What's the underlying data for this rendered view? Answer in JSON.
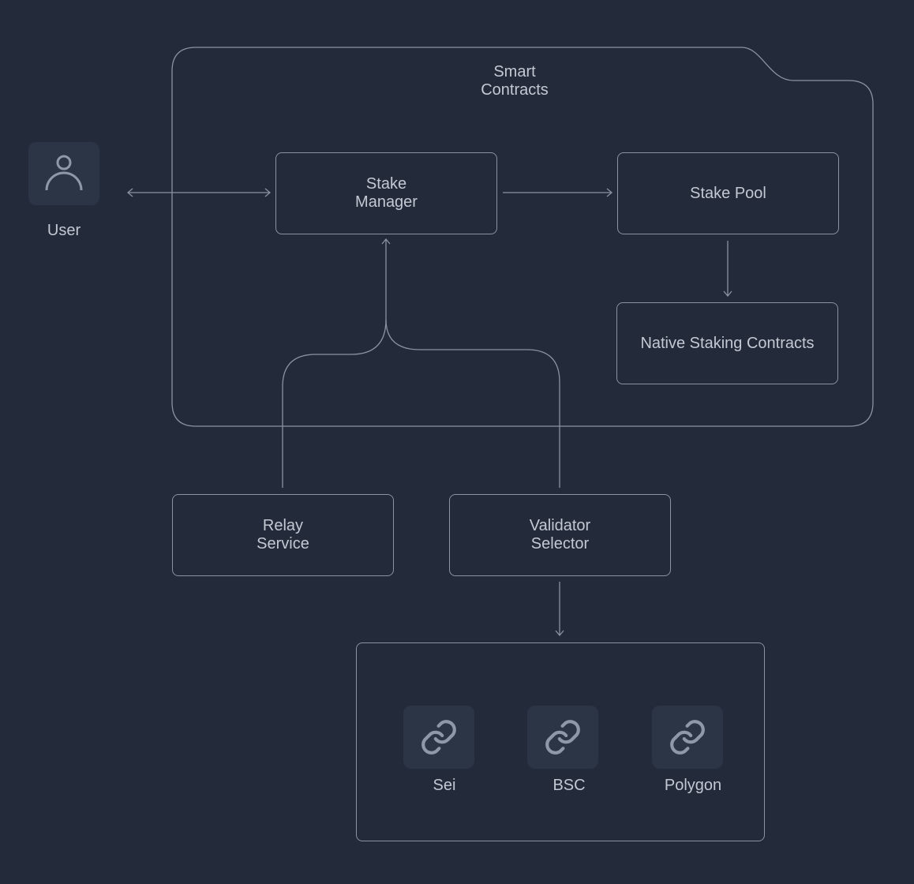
{
  "container": {
    "title": "Smart Contracts"
  },
  "user": {
    "label": "User",
    "icon": "user-icon"
  },
  "nodes": {
    "stake_manager": "Stake\nManager",
    "stake_pool": "Stake Pool",
    "native_staking": "Native Staking Contracts",
    "relay_service": "Relay\nService",
    "validator_selector": "Validator\nSelector"
  },
  "chains": [
    {
      "label": "Sei",
      "icon": "link-icon"
    },
    {
      "label": "BSC",
      "icon": "link-icon"
    },
    {
      "label": "Polygon",
      "icon": "link-icon"
    }
  ],
  "colors": {
    "background": "#232b3b",
    "stroke": "#8a93a3",
    "text": "#c3c9d3",
    "icon_bg": "#2c3546"
  }
}
